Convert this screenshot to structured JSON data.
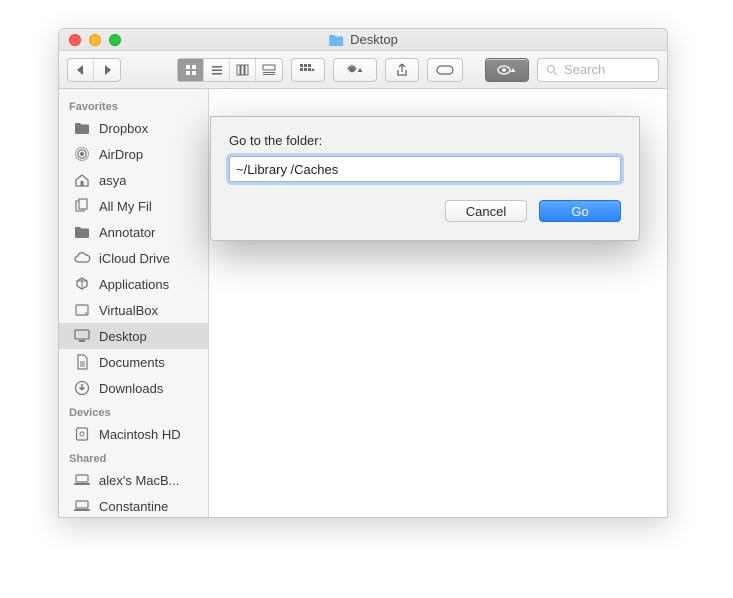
{
  "window": {
    "title": "Desktop"
  },
  "toolbar": {
    "search_placeholder": "Search"
  },
  "sidebar": {
    "sections": [
      {
        "header": "Favorites",
        "items": [
          {
            "label": "Dropbox",
            "icon": "folder"
          },
          {
            "label": "AirDrop",
            "icon": "airdrop"
          },
          {
            "label": "asya",
            "icon": "home"
          },
          {
            "label": "All My Fil",
            "icon": "allfiles"
          },
          {
            "label": "Annotator",
            "icon": "folder"
          },
          {
            "label": "iCloud Drive",
            "icon": "cloud"
          },
          {
            "label": "Applications",
            "icon": "apps"
          },
          {
            "label": "VirtualBox",
            "icon": "disk"
          },
          {
            "label": "Desktop",
            "icon": "desktop",
            "selected": true
          },
          {
            "label": "Documents",
            "icon": "doc"
          },
          {
            "label": "Downloads",
            "icon": "download"
          }
        ]
      },
      {
        "header": "Devices",
        "items": [
          {
            "label": "Macintosh HD",
            "icon": "hdd"
          }
        ]
      },
      {
        "header": "Shared",
        "items": [
          {
            "label": "alex's MacB...",
            "icon": "laptop"
          },
          {
            "label": "Constantine",
            "icon": "laptop"
          }
        ]
      }
    ]
  },
  "dialog": {
    "label": "Go to the folder:",
    "value": "~/Library /Caches",
    "cancel": "Cancel",
    "go": "Go"
  }
}
